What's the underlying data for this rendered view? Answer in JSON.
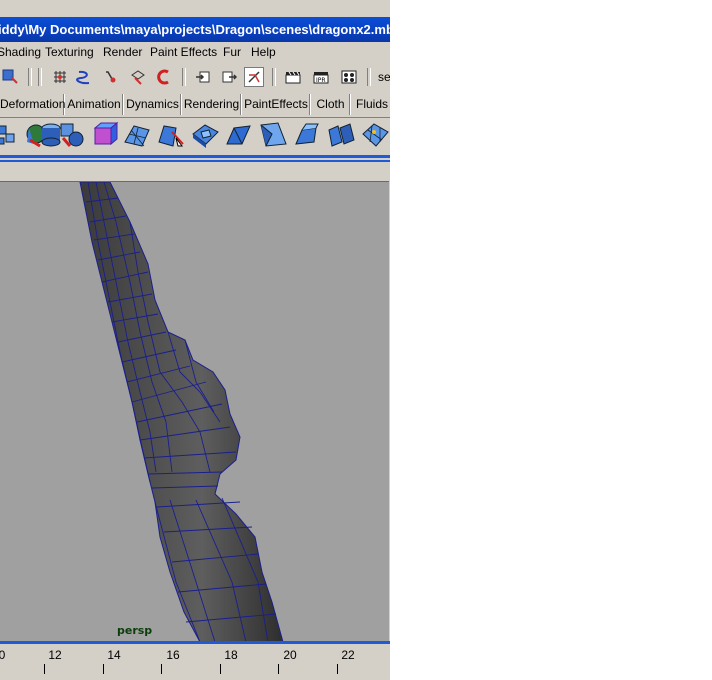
{
  "window": {
    "title": "iddy\\My Documents\\maya\\projects\\Dragon\\scenes\\dragonx2.mb"
  },
  "menubar": {
    "items": [
      "Shading",
      "Texturing",
      "Render",
      "Paint Effects",
      "Fur",
      "Help"
    ]
  },
  "toolbar": {
    "truncated_label": "se"
  },
  "shelf_tabs": [
    "Deformation",
    "Animation",
    "Dynamics",
    "Rendering",
    "PaintEffects",
    "Cloth",
    "Fluids"
  ],
  "viewport": {
    "camera_label": "persp"
  },
  "timeline": {
    "ticks": [
      "0",
      "12",
      "14",
      "16",
      "18",
      "20",
      "22"
    ]
  },
  "colors": {
    "title_bar": "#0a3fbf",
    "ui_gray": "#d4d0c8",
    "viewport_bg": "#a0a0a0",
    "wireframe": "#1a1f8c",
    "accent_blue": "#1d5bd8"
  }
}
